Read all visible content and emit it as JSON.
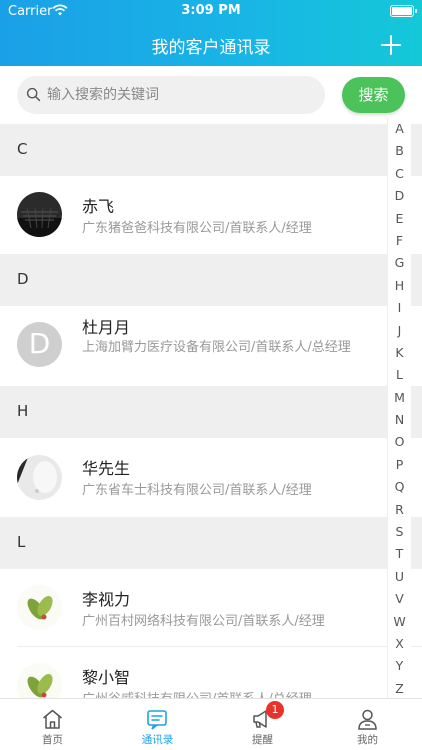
{
  "status_bar": {
    "carrier": "Carrier",
    "time": "3:09 PM"
  },
  "header": {
    "title": "我的客户通讯录",
    "add_icon": "plus-icon"
  },
  "search": {
    "placeholder": "输入搜索的关键词",
    "value": "",
    "button_label": "搜索"
  },
  "sections": [
    {
      "letter": "C",
      "contacts": [
        {
          "name": "赤飞",
          "subtitle": "广东猪爸爸科技有限公司/首联系人/经理",
          "avatar": "photo-dark"
        }
      ]
    },
    {
      "letter": "D",
      "contacts": [
        {
          "name": "杜月月",
          "subtitle": "上海加臂力医疗设备有限公司/首联系人/总经理",
          "avatar_letter": "D"
        }
      ]
    },
    {
      "letter": "H",
      "contacts": [
        {
          "name": "华先生",
          "subtitle": "广东省车士科技有限公司/首联系人/经理",
          "avatar": "photo-light"
        }
      ]
    },
    {
      "letter": "L",
      "contacts": [
        {
          "name": "李视力",
          "subtitle": "广州百村网络科技有限公司/首联系人/经理",
          "avatar": "photo-leaves"
        },
        {
          "name": "黎小智",
          "subtitle": "广州谷威科技有限公司/首联系人/总经理",
          "avatar": "photo-leaves"
        }
      ]
    }
  ],
  "index_letters": [
    "A",
    "B",
    "C",
    "D",
    "E",
    "F",
    "G",
    "H",
    "I",
    "J",
    "K",
    "L",
    "M",
    "N",
    "O",
    "P",
    "Q",
    "R",
    "S",
    "T",
    "U",
    "V",
    "W",
    "X",
    "Y",
    "Z"
  ],
  "tabbar": {
    "home": {
      "label": "首页",
      "icon": "home-icon"
    },
    "contacts": {
      "label": "通讯录",
      "icon": "contacts-icon"
    },
    "reminders": {
      "label": "提醒",
      "icon": "megaphone-icon",
      "badge": "1"
    },
    "mine": {
      "label": "我的",
      "icon": "user-icon"
    }
  },
  "colors": {
    "header_start": "#1aa0e6",
    "header_end": "#14c8d8",
    "search_button": "#4cc35a",
    "active_tab": "#1ca3e6",
    "badge": "#e8332c"
  }
}
